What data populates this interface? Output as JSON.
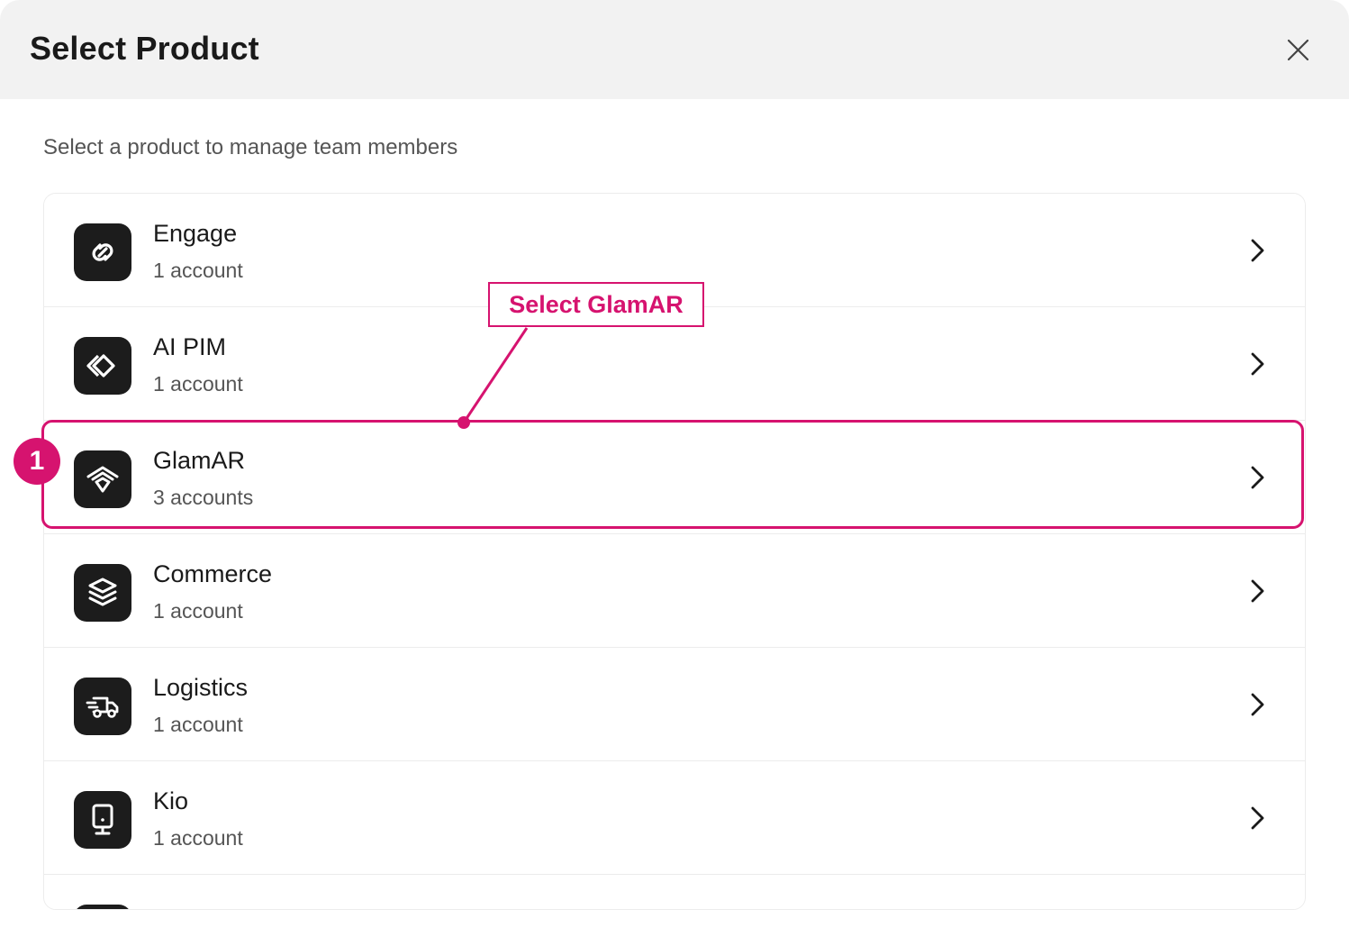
{
  "modal": {
    "title": "Select Product",
    "close_icon": "close-icon",
    "subtitle": "Select a product to manage team members"
  },
  "products": [
    {
      "name": "Engage",
      "count": "1 account",
      "icon": "engage-icon"
    },
    {
      "name": "AI PIM",
      "count": "1 account",
      "icon": "ai-pim-icon"
    },
    {
      "name": "GlamAR",
      "count": "3 accounts",
      "icon": "glamar-icon"
    },
    {
      "name": "Commerce",
      "count": "1 account",
      "icon": "layers-icon"
    },
    {
      "name": "Logistics",
      "count": "1 account",
      "icon": "truck-icon"
    },
    {
      "name": "Kio",
      "count": "1 account",
      "icon": "kiosk-icon"
    }
  ],
  "annotation": {
    "label": "Select GlamAR",
    "step": "1",
    "color": "#d6136f"
  },
  "colors": {
    "header_bg": "#f2f2f2",
    "icon_bg": "#1c1c1c",
    "accent": "#d6136f"
  }
}
